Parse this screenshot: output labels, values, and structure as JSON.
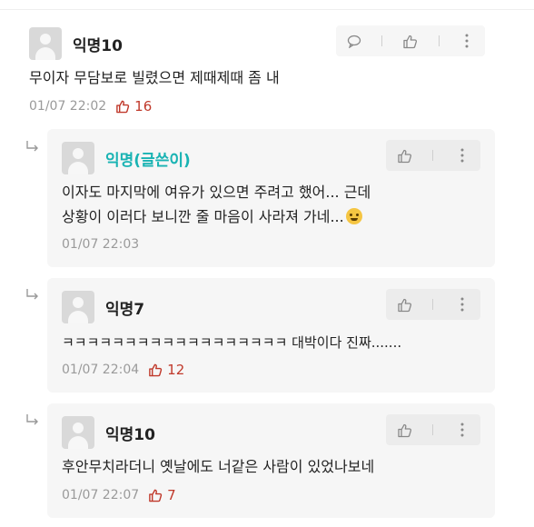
{
  "main_comment": {
    "author": "익명10",
    "text": "무이자 무담보로 빌렸으면 제때제때 좀 내",
    "timestamp": "01/07 22:02",
    "likes": "16"
  },
  "replies": [
    {
      "author": "익명(글쓴이)",
      "text_line1": "이자도 마지막에 여유가 있으면 주려고 했어... 근데",
      "text_line2": "상황이 이러다 보니깐 줄 마음이 사라져 가네...",
      "timestamp": "01/07 22:03"
    },
    {
      "author": "익명7",
      "text": "ㅋㅋㅋㅋㅋㅋㅋㅋㅋㅋㅋㅋㅋㅋㅋㅋㅋㅋ 대박이다 진짜.......",
      "timestamp": "01/07 22:04",
      "likes": "12"
    },
    {
      "author": "익명10",
      "text": "후안무치라더니 옛날에도 너같은 사람이 있었나보네",
      "timestamp": "01/07 22:07",
      "likes": "7"
    }
  ],
  "colors": {
    "op_name": "#19b3b3",
    "like_accent": "#c0392b",
    "meta_gray": "#9a9a9a",
    "reply_bg": "#f6f6f6"
  },
  "icons": [
    "reply-speech-bubble-icon",
    "thumbs-up-icon",
    "more-vertical-icon",
    "reply-arrow-icon",
    "crying-cat-emoji"
  ]
}
